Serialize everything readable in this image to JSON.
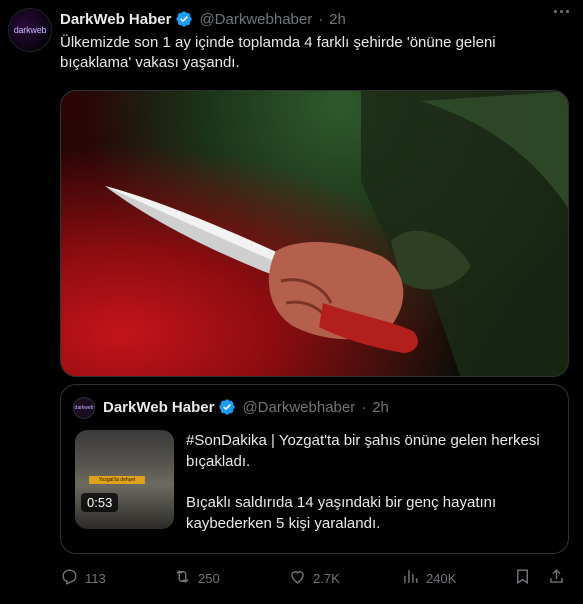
{
  "tweet": {
    "display_name": "DarkWeb Haber",
    "handle": "@Darkwebhaber",
    "separator": "·",
    "time": "2h",
    "avatar_text": "darkweb",
    "text": "Ülkemizde son 1 ay içinde toplamda 4 farklı şehirde 'önüne geleni bıçaklama' vakası yaşandı.",
    "verified": true,
    "icons": {
      "more": "more-horizontal-icon",
      "verified": "verified-badge-icon"
    }
  },
  "quote": {
    "display_name": "DarkWeb Haber",
    "handle": "@Darkwebhaber",
    "separator": "·",
    "time": "2h",
    "avatar_text": "darkweb",
    "video_duration": "0:53",
    "video_banner": "Yozgat'ta dehşet",
    "paragraph1": "#SonDakika | Yozgat'ta bir şahıs önüne gelen herkesi bıçakladı.",
    "paragraph2": "Bıçaklı saldırıda 14 yaşındaki bir genç hayatını kaybederken 5 kişi yaralandı."
  },
  "actions": {
    "replies": "113",
    "reposts": "250",
    "likes": "2.7K",
    "views": "240K",
    "icons": [
      "reply-icon",
      "repost-icon",
      "like-icon",
      "views-icon",
      "bookmark-icon",
      "share-icon"
    ]
  },
  "colors": {
    "background": "#000000",
    "text": "#e7e9ea",
    "muted": "#71767b",
    "border": "#2f3336",
    "verified": "#1d9bf0"
  }
}
